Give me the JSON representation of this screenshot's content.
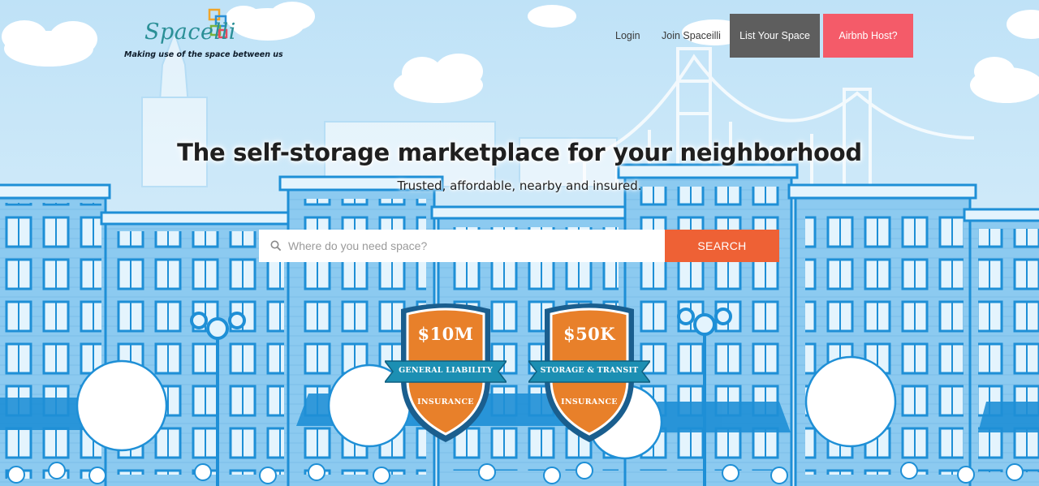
{
  "logo": {
    "name": "Spacelli",
    "tagline": "Making use of the space between us"
  },
  "nav": {
    "login": "Login",
    "join": "Join Spaceilli",
    "list_space": "List Your Space",
    "airbnb_host": "Airbnb Host?"
  },
  "hero": {
    "title": "The self-storage marketplace for your neighborhood",
    "subtitle": "Trusted, affordable, nearby and insured."
  },
  "search": {
    "placeholder": "Where do you need space?",
    "button": "SEARCH"
  },
  "badges": [
    {
      "amount": "$10M",
      "ribbon": "GENERAL LIABILITY",
      "bottom": "INSURANCE"
    },
    {
      "amount": "$50K",
      "ribbon": "STORAGE & TRANSIT",
      "bottom": "INSURANCE"
    }
  ],
  "colors": {
    "sky": "#cfe9f8",
    "building_blue": "#8cc8ef",
    "outline_blue": "#1e8fd6",
    "list_button": "#5e5e5e",
    "airbnb_button": "#f45b69",
    "search_button": "#ee6135",
    "badge_orange": "#e8802a",
    "badge_ribbon": "#1c8fb3"
  }
}
